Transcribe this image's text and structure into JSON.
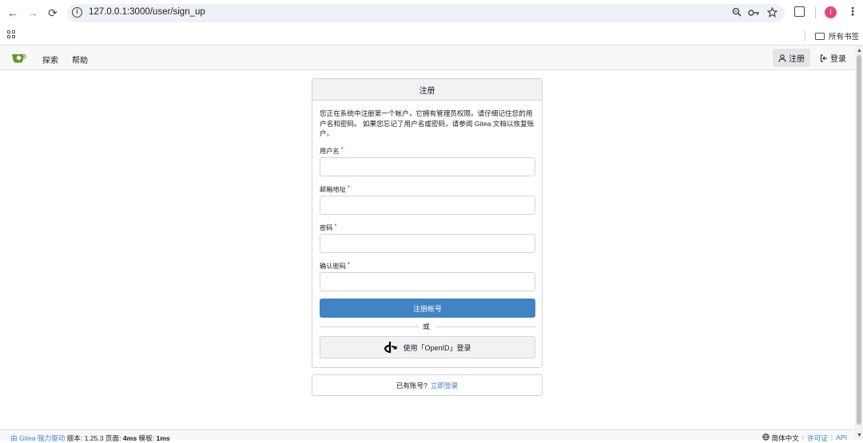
{
  "browser": {
    "url": "127.0.0.1:3000/user/sign_up",
    "back_icon": "←",
    "forward_icon": "→",
    "reload_icon": "⟳",
    "profile_initial": "I",
    "bookmarks_folder": "所有书签"
  },
  "navbar": {
    "explore": "探索",
    "help": "帮助",
    "register": "注册",
    "login": "登录"
  },
  "form": {
    "title": "注册",
    "notice": "您正在系统中注册第一个帐户，它拥有管理员权限。请仔细记住您的用户名和密码。 如果您忘记了用户名或密码，请参阅 Gitea 文档以恢复账户。",
    "username_label": "用户名",
    "email_label": "邮箱地址",
    "password_label": "密码",
    "confirm_label": "确认密码",
    "required_mark": "*",
    "submit": "注册帐号",
    "or": "或",
    "openid": "使用「OpenID」登录"
  },
  "login_prompt": {
    "text": "已有账号?",
    "link": "立即登录"
  },
  "footer": {
    "powered": "由 Gitea 强力驱动",
    "version": "版本: 1.25.3 页面:",
    "page_time": "4ms",
    "template_label": "模板:",
    "template_time": "1ms",
    "language": "简体中文",
    "license": "许可证",
    "api": "API"
  },
  "colors": {
    "accent": "#4183c4",
    "required": "#db2828",
    "gitea_green": "#609926"
  }
}
